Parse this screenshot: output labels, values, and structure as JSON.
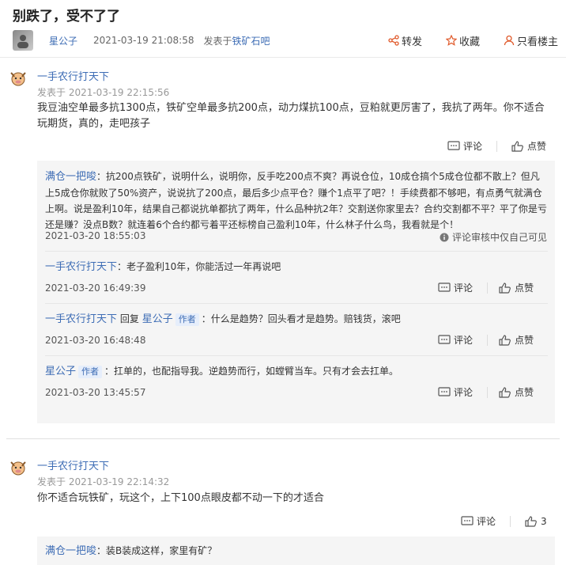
{
  "post": {
    "title": "别跌了，受不了了",
    "author": "星公子",
    "time": "2021-03-19 21:08:58",
    "source_prefix": "发表于",
    "source_link": "铁矿石吧",
    "actions": {
      "share": "转发",
      "favorite": "收藏",
      "only_owner": "只看楼主"
    }
  },
  "replies": [
    {
      "user": "一手农行打天下",
      "time": "发表于 2021-03-19 22:15:56",
      "content": "我豆油空单最多抗1300点，铁矿空单最多抗200点，动力煤抗100点，豆粕就更厉害了，我抗了两年。你不适合玩期货，真的，走吧孩子",
      "comment": "评论",
      "like": "点赞",
      "subs": [
        {
          "user": "满仓一把唆",
          "tag": "",
          "reply_to": "",
          "text": "：抗200点铁矿，说明什么，说明你，反手吃200点不爽？再说仓位，10成仓搞个5成仓位都不散上？但凡上5成仓你就败了50%资产，说说抗了200点，最后多少点平仓？赚个1点平了吧？！手续费都不够吧，有点勇气就满仓上啊。说是盈利10年，结果自己都说抗单都抗了两年，什么品种抗2年？交割送你家里去？合约交割都不平？平了你是亏还是赚？没点B数？就连着6个合约都亏着平还标榜自己盈利10年，什么林子什么鸟，我看就是个！",
          "time": "2021-03-20 18:55:03",
          "audit": "评论审核中仅自己可见"
        },
        {
          "user": "一手农行打天下",
          "tag": "",
          "reply_to": "",
          "text": "：老子盈利10年，你能活过一年再说吧",
          "time": "2021-03-20 16:49:39",
          "comment": "评论",
          "like": "点赞"
        },
        {
          "user": "一手农行打天下",
          "reply_word": "回复",
          "reply_to": "星公子",
          "tag": "作者",
          "text": "：什么是趋势？回头看才是趋势。赔钱货，滚吧",
          "time": "2021-03-20 16:48:48",
          "comment": "评论",
          "like": "点赞"
        },
        {
          "user": "星公子",
          "tag": "作者",
          "reply_to": "",
          "text": "：扛单的，也配指导我。逆趋势而行，如螳臂当车。只有才会去扛单。",
          "time": "2021-03-20 13:45:57",
          "comment": "评论",
          "like": "点赞"
        }
      ]
    },
    {
      "user": "一手农行打天下",
      "time": "发表于 2021-03-19 22:14:32",
      "content": "你不适合玩铁矿，玩这个，上下100点眼皮都不动一下的才适合",
      "comment": "评论",
      "like_count": "3",
      "subs": [
        {
          "user": "满仓一把唆",
          "text": "：装B装成这样，家里有矿？"
        }
      ]
    }
  ]
}
